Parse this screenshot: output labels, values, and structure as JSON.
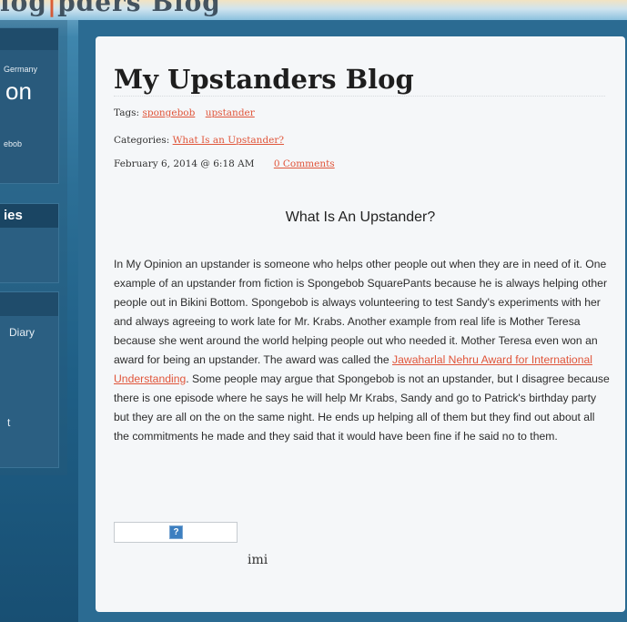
{
  "header": {
    "cut_title_part1": "log",
    "cut_title_part2": "|",
    "cut_title_part3": "pders Blog"
  },
  "sidebar": {
    "panel1": {
      "line1": "Germany",
      "line2": "on",
      "line3": "ebob"
    },
    "panel2": {
      "heading": "ies"
    },
    "panel3": {
      "item1": "Diary",
      "item2": "t"
    }
  },
  "post": {
    "title": "My Upstanders Blog",
    "tags_label": "Tags:",
    "tags": [
      "spongebob",
      "upstander"
    ],
    "categories_label": "Categories:",
    "category": "What Is an Upstander?",
    "date": "February 6, 2014 @ 6:18 AM",
    "comments": "0 Comments",
    "heading": "What Is An Upstander?",
    "body_part1": "In My Opinion an upstander is someone who helps other people out when they are in need of it.  One example of an upstander from fiction is Spongebob SquarePants because he is always helping other people out in Bikini Bottom. Spongebob is always volunteering to test Sandy's experiments with her and always agreeing to work late for Mr. Krabs.  Another example from real life is Mother Teresa because she went around the world helping people out who needed it.  Mother Teresa even won an award for being an upstander.  The award was called the ",
    "body_link": "Jawaharlal Nehru Award for International Understanding",
    "body_part2": ".  Some people may argue that Spongebob is not an upstander, but I disagree because there is one episode where he says he will help Mr Krabs, Sandy and go to Patrick's birthday party but they are all on the  on the same night.  He ends up helping all of them but they find out about all the commitments he made and they said that it would have been fine if he said no to them.",
    "embed_placeholder": "?",
    "footer_text": "imi"
  },
  "colors": {
    "link": "#e0553a",
    "content_bg": "#f5f7f9",
    "sidebar_panel": "#2b5f82"
  }
}
